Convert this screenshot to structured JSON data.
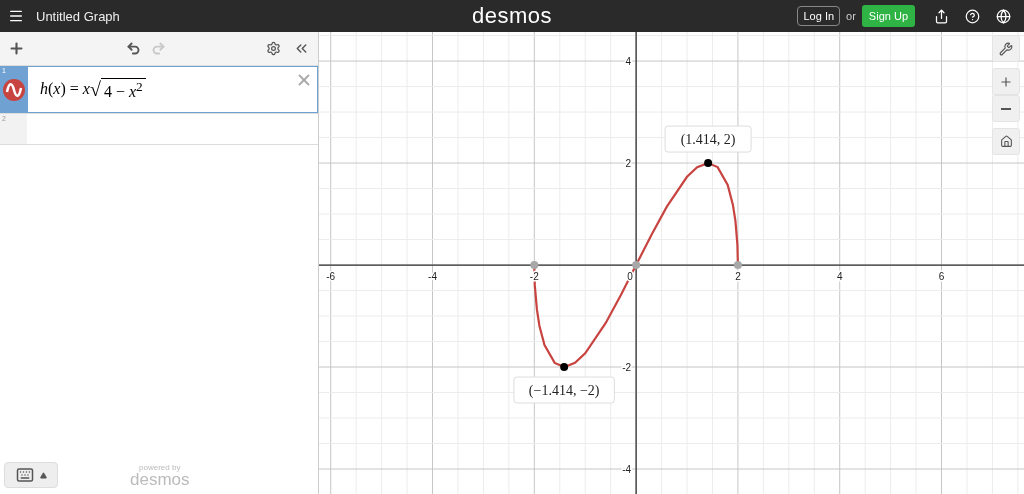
{
  "header": {
    "title": "Untitled Graph",
    "logo": "desmos",
    "login": "Log In",
    "or": "or",
    "signup": "Sign Up"
  },
  "toolbar": {
    "undo": {
      "disabled": false
    },
    "redo": {
      "disabled": true
    }
  },
  "expressions": [
    {
      "number": "1",
      "selected": true,
      "color": "#c74440",
      "lhs": "*h*(*x*) = *x*",
      "radical": "√",
      "radicand": "4 − *x*$^{2}$"
    },
    {
      "number": "2",
      "selected": false
    }
  ],
  "footer": {
    "powered_by": "powered by",
    "brand": "desmos"
  },
  "graph": {
    "chart_data": {
      "type": "line",
      "grid": true,
      "xlim": [
        -6.23,
        7.62
      ],
      "ylim": [
        -4.49,
        4.57
      ],
      "xticks": [
        -6,
        -4,
        -2,
        0,
        2,
        4,
        6
      ],
      "yticks": [
        -4,
        -2,
        2,
        4
      ],
      "x": [
        -2,
        -1.99,
        -1.95,
        -1.9,
        -1.8,
        -1.6,
        -1.41,
        -1.2,
        -1,
        -0.6,
        -0.3,
        0,
        0.3,
        0.6,
        1,
        1.2,
        1.41,
        1.6,
        1.8,
        1.9,
        1.95,
        1.99,
        2
      ],
      "series": [
        {
          "color": "#c74440",
          "values": [
            0,
            -0.4,
            -0.87,
            -1.19,
            -1.57,
            -1.92,
            -2,
            -1.92,
            -1.73,
            -1.14,
            -0.59,
            0,
            0.59,
            1.14,
            1.73,
            1.92,
            2,
            1.92,
            1.57,
            1.19,
            0.87,
            0.4,
            0
          ]
        }
      ],
      "annotations": [
        {
          "x": 1.414,
          "y": 2,
          "text": "(1.414, 2)"
        },
        {
          "x": -1.414,
          "y": -2,
          "text": "(−1.414, −2)"
        }
      ]
    }
  }
}
